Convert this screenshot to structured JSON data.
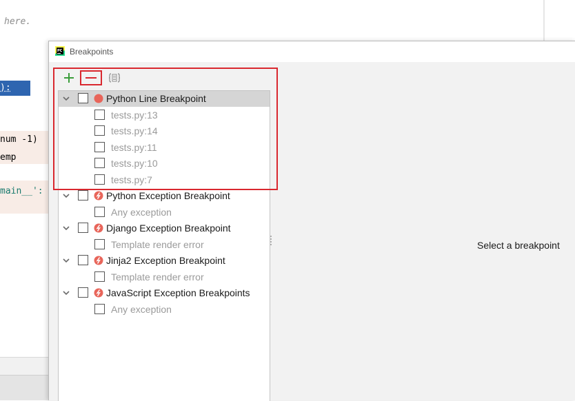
{
  "editor": {
    "comment": "here.",
    "selected_code": "):",
    "pink_line_1": "num -1)",
    "pink_line_2": "emp",
    "main_line": "main__':"
  },
  "dialog": {
    "title": "Breakpoints",
    "toolbar": {
      "add_icon": "plus-icon",
      "remove_icon": "minus-icon",
      "group_icon": "group-icon"
    },
    "detail_placeholder": "Select a breakpoint",
    "colors": {
      "highlight_frame": "#d9272e",
      "add_green": "#3a9d3a",
      "breakpoint_red": "#e8655a",
      "selected_row": "#d5d5d5"
    }
  },
  "groups": [
    {
      "label": "Python Line Breakpoint",
      "icon": "line-breakpoint-icon",
      "expanded": true,
      "selected": true,
      "children": [
        "tests.py:13",
        "tests.py:14",
        "tests.py:11",
        "tests.py:10",
        "tests.py:7"
      ]
    },
    {
      "label": "Python Exception Breakpoint",
      "icon": "exception-breakpoint-icon",
      "expanded": true,
      "children": [
        "Any exception"
      ]
    },
    {
      "label": "Django Exception Breakpoint",
      "icon": "exception-breakpoint-icon",
      "expanded": true,
      "children": [
        "Template render error"
      ]
    },
    {
      "label": "Jinja2 Exception Breakpoint",
      "icon": "exception-breakpoint-icon",
      "expanded": true,
      "children": [
        "Template render error"
      ]
    },
    {
      "label": "JavaScript Exception Breakpoints",
      "icon": "exception-breakpoint-icon",
      "expanded": true,
      "children": [
        "Any exception"
      ]
    }
  ]
}
